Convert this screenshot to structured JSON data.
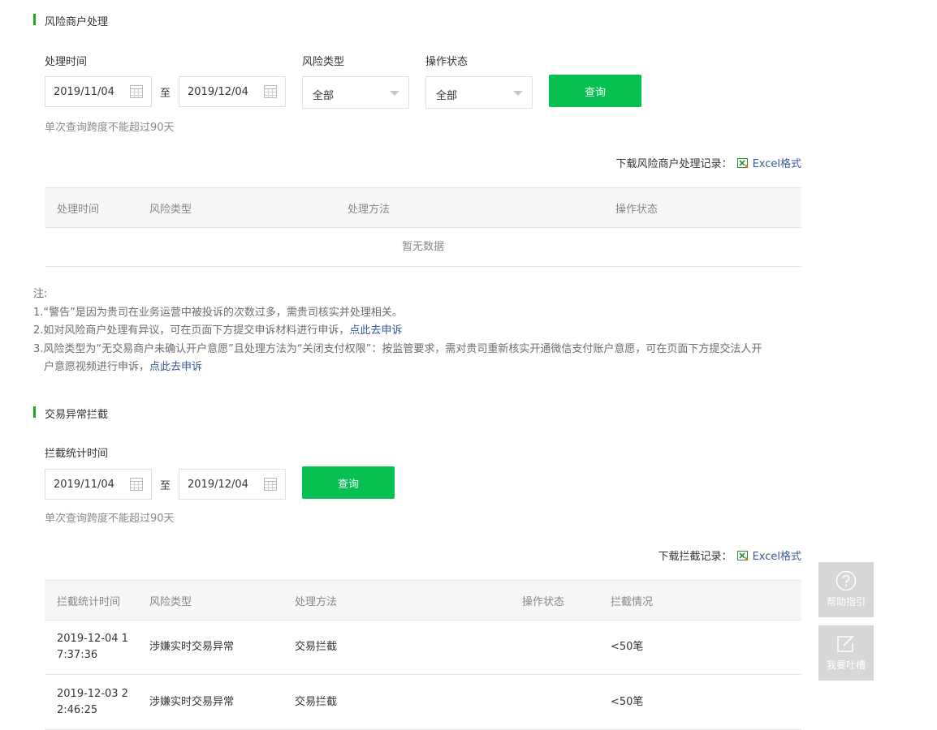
{
  "risk": {
    "title": "风险商户处理",
    "labels": {
      "time": "处理时间",
      "type": "风险类型",
      "status": "操作状态"
    },
    "start_date": "2019/11/04",
    "to": "至",
    "end_date": "2019/12/04",
    "type_value": "全部",
    "status_value": "全部",
    "query": "查询",
    "hint": "单次查询跨度不能超过90天",
    "download_label": "下载风险商户处理记录：",
    "excel": "Excel格式",
    "columns": [
      "处理时间",
      "风险类型",
      "处理方法",
      "操作状态"
    ],
    "empty": "暂无数据"
  },
  "notes": {
    "head": "注:",
    "line1": "1.“警告”是因为贵司在业务运营中被投诉的次数过多，需贵司核实并处理相关。",
    "line2": "2.如对风险商户处理有异议，可在页面下方提交申诉材料进行申诉，",
    "line2_link": "点此去申诉",
    "line3": "3.风险类型为“无交易商户未确认开户意愿”且处理方法为“关闭支付权限”：按监管要求，需对贵司重新核实开通微信支付账户意愿，可在页面下方提交法人开",
    "line3b": "户意愿视频进行申诉，",
    "line3_link": "点此去申诉"
  },
  "intercept": {
    "title": "交易异常拦截",
    "label": "拦截统计时间",
    "start_date": "2019/11/04",
    "to": "至",
    "end_date": "2019/12/04",
    "query": "查询",
    "hint": "单次查询跨度不能超过90天",
    "download_label": "下载拦截记录：",
    "excel": "Excel格式",
    "columns": [
      "拦截统计时间",
      "风险类型",
      "处理方法",
      "操作状态",
      "拦截情况"
    ],
    "rows": [
      {
        "time_a": "2019-12-04 1",
        "time_b": "7:37:36",
        "type": "涉嫌实时交易异常",
        "method": "交易拦截",
        "status": "",
        "result": "<50笔"
      },
      {
        "time_a": "2019-12-03 2",
        "time_b": "2:46:25",
        "type": "涉嫌实时交易异常",
        "method": "交易拦截",
        "status": "",
        "result": "<50笔"
      }
    ]
  },
  "floating": {
    "help": "帮助指引",
    "feedback": "我要吐槽"
  },
  "colors": {
    "accent": "#06c152",
    "link": "#3b5998",
    "section_bar": "#1aad19"
  }
}
